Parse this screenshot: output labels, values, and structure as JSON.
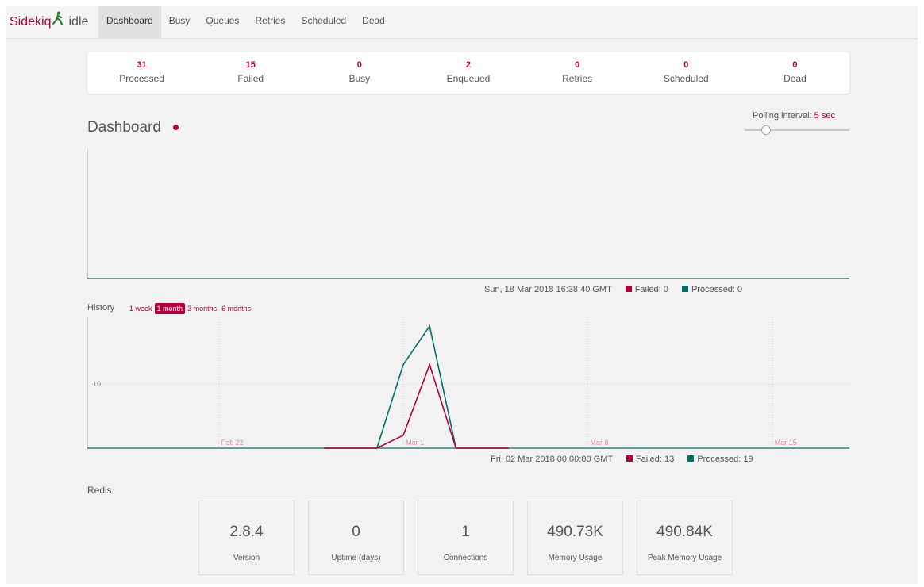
{
  "brand": {
    "name": "Sidekiq",
    "status": "idle"
  },
  "nav": [
    {
      "label": "Dashboard",
      "active": true
    },
    {
      "label": "Busy"
    },
    {
      "label": "Queues"
    },
    {
      "label": "Retries"
    },
    {
      "label": "Scheduled"
    },
    {
      "label": "Dead"
    }
  ],
  "summary": [
    {
      "value": "31",
      "label": "Processed"
    },
    {
      "value": "15",
      "label": "Failed"
    },
    {
      "value": "0",
      "label": "Busy"
    },
    {
      "value": "2",
      "label": "Enqueued"
    },
    {
      "value": "0",
      "label": "Retries"
    },
    {
      "value": "0",
      "label": "Scheduled"
    },
    {
      "value": "0",
      "label": "Dead"
    }
  ],
  "dashboard": {
    "title": "Dashboard",
    "polling_label": "Polling interval:",
    "polling_value": "5 sec",
    "polling_seconds": 5
  },
  "realtime": {
    "timestamp": "Sun, 18 Mar 2018 16:38:40 GMT",
    "failed_label": "Failed: 0",
    "processed_label": "Processed: 0"
  },
  "history": {
    "title": "History",
    "tabs": [
      "1 week",
      "1 month",
      "3 months",
      "6 months"
    ],
    "active_tab": "1 month",
    "timestamp": "Fri, 02 Mar 2018 00:00:00 GMT",
    "failed_label": "Failed: 13",
    "processed_label": "Processed: 19"
  },
  "colors": {
    "failed": "#b1003e",
    "processed": "#006f68",
    "accent": "#b1003e"
  },
  "chart_data": [
    {
      "type": "line",
      "series": [
        {
          "name": "Failed",
          "values": []
        },
        {
          "name": "Processed",
          "values": []
        }
      ]
    },
    {
      "type": "line",
      "x": [
        "Feb 26",
        "Feb 27",
        "Feb 28",
        "Mar 1",
        "Mar 2",
        "Mar 3",
        "Mar 4",
        "Mar 5"
      ],
      "series": [
        {
          "name": "Failed",
          "values": [
            0,
            0,
            0,
            2,
            13,
            0,
            0,
            0
          ]
        },
        {
          "name": "Processed",
          "values": [
            0,
            0,
            0,
            13,
            19,
            0,
            0,
            0
          ]
        }
      ],
      "xtick_labels": [
        "Feb 22",
        "Mar 1",
        "Mar 8",
        "Mar 15"
      ],
      "ytick_labels": [
        "10"
      ],
      "ylim": [
        0,
        20
      ],
      "grid": true
    }
  ],
  "redis": {
    "title": "Redis",
    "stats": [
      {
        "value": "2.8.4",
        "label": "Version"
      },
      {
        "value": "0",
        "label": "Uptime (days)"
      },
      {
        "value": "1",
        "label": "Connections"
      },
      {
        "value": "490.73K",
        "label": "Memory Usage"
      },
      {
        "value": "490.84K",
        "label": "Peak Memory Usage"
      }
    ]
  }
}
